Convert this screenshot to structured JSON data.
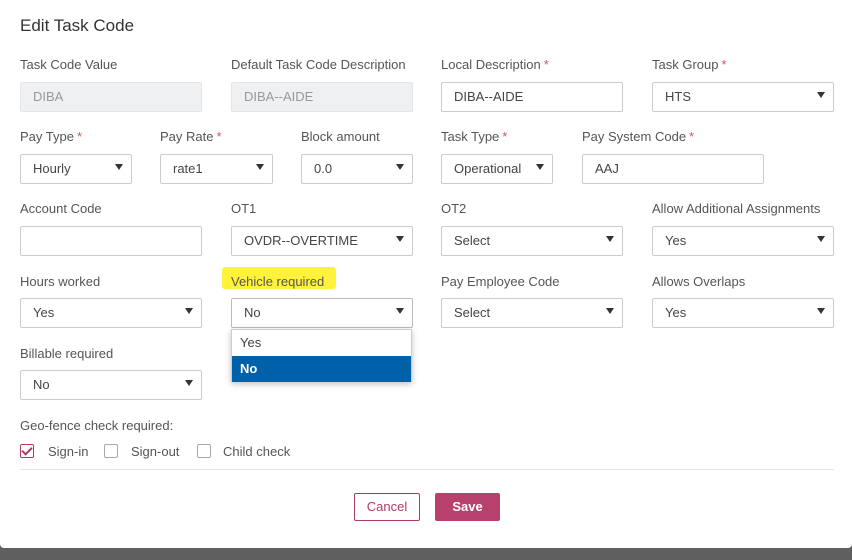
{
  "dialog": {
    "title": "Edit Task Code"
  },
  "fields": {
    "task_code_value": {
      "label": "Task Code Value",
      "value": "DIBA"
    },
    "default_description": {
      "label": "Default Task Code Description",
      "value": "DIBA--AIDE"
    },
    "local_description": {
      "label": "Local Description",
      "value": "DIBA--AIDE",
      "required": "*"
    },
    "task_group": {
      "label": "Task Group",
      "value": "HTS",
      "required": "*"
    },
    "pay_type": {
      "label": "Pay Type",
      "value": "Hourly",
      "required": "*"
    },
    "pay_rate": {
      "label": "Pay Rate",
      "value": "rate1",
      "required": "*"
    },
    "block_amount": {
      "label": "Block amount",
      "value": "0.0"
    },
    "task_type": {
      "label": "Task Type",
      "value": "Operational",
      "required": "*"
    },
    "pay_system_code": {
      "label": "Pay System Code",
      "value": "AAJ",
      "required": "*"
    },
    "account_code": {
      "label": "Account Code",
      "value": ""
    },
    "ot1": {
      "label": "OT1",
      "value": "OVDR--OVERTIME"
    },
    "ot2": {
      "label": "OT2",
      "value": "Select"
    },
    "allow_additional": {
      "label": "Allow Additional Assignments",
      "value": "Yes"
    },
    "hours_worked": {
      "label": "Hours worked",
      "value": "Yes"
    },
    "vehicle_required": {
      "label": "Vehicle required",
      "value": "No",
      "options": [
        "Yes",
        "No"
      ]
    },
    "pay_employee_code": {
      "label": "Pay Employee Code",
      "value": "Select"
    },
    "allows_overlaps": {
      "label": "Allows Overlaps",
      "value": "Yes"
    },
    "billable_required": {
      "label": "Billable required",
      "value": "No"
    }
  },
  "geofence": {
    "label": "Geo-fence check required:",
    "options": [
      {
        "label": "Sign-in",
        "checked": true
      },
      {
        "label": "Sign-out",
        "checked": false
      },
      {
        "label": "Child check",
        "checked": false
      }
    ]
  },
  "buttons": {
    "cancel": "Cancel",
    "save": "Save"
  },
  "colors": {
    "accent": "#b8406c",
    "selected_option": "#0060a8",
    "highlight": "#fff23a"
  }
}
